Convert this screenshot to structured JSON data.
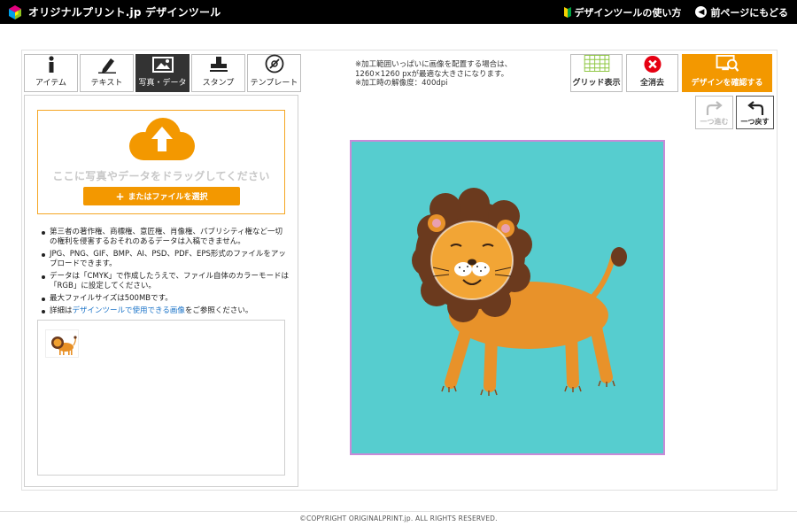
{
  "header": {
    "logo_text": "オリジナルプリント.jp デザインツール",
    "guide_link": "デザインツールの使い方",
    "back_link": "前ページにもどる"
  },
  "tabs": [
    {
      "label": "アイテム",
      "icon": "info-icon"
    },
    {
      "label": "テキスト",
      "icon": "pen-icon"
    },
    {
      "label": "写真・データ",
      "icon": "image-icon"
    },
    {
      "label": "スタンプ",
      "icon": "stamp-icon"
    },
    {
      "label": "テンプレート",
      "icon": "template-icon"
    }
  ],
  "upload": {
    "drop_text": "ここに写真やデータをドラッグしてください",
    "select_button": "またはファイルを選択",
    "notes": [
      "第三者の著作権、商標権、意匠権、肖像権、パブリシティ権など一切の権利を侵害するおそれのあるデータは入稿できません。",
      "JPG、PNG、GIF、BMP、AI、PSD、PDF、EPS形式のファイルをアップロードできます。",
      "データは「CMYK」で作成したうえで、ファイル自体のカラーモードは「RGB」に設定してください。",
      "最大ファイルサイズは500MBです。"
    ],
    "note_link_prefix": "詳細は",
    "note_link_text": "デザインツールで使用できる画像",
    "note_link_suffix": "をご参照ください。"
  },
  "info": {
    "line1": "※加工範囲いっぱいに画像を配置する場合は、",
    "line2": "1260×1260 pxが最適な大きさになります。",
    "line3": "※加工時の解像度：400dpi"
  },
  "toolbar": {
    "grid_label": "グリッド表示",
    "clear_label": "全消去",
    "confirm_label": "デザインを確認する",
    "redo_label": "一つ進む",
    "undo_label": "一つ戻す"
  },
  "canvas": {
    "background_color": "#56cdcf",
    "border_color": "#c98ad8"
  },
  "footer": {
    "copyright": "©COPYRIGHT ORIGINALPRINT.jp. ALL RIGHTS RESERVED."
  },
  "colors": {
    "accent": "#f39800",
    "clear_red": "#e60012",
    "grid_green": "#8cc63f"
  }
}
